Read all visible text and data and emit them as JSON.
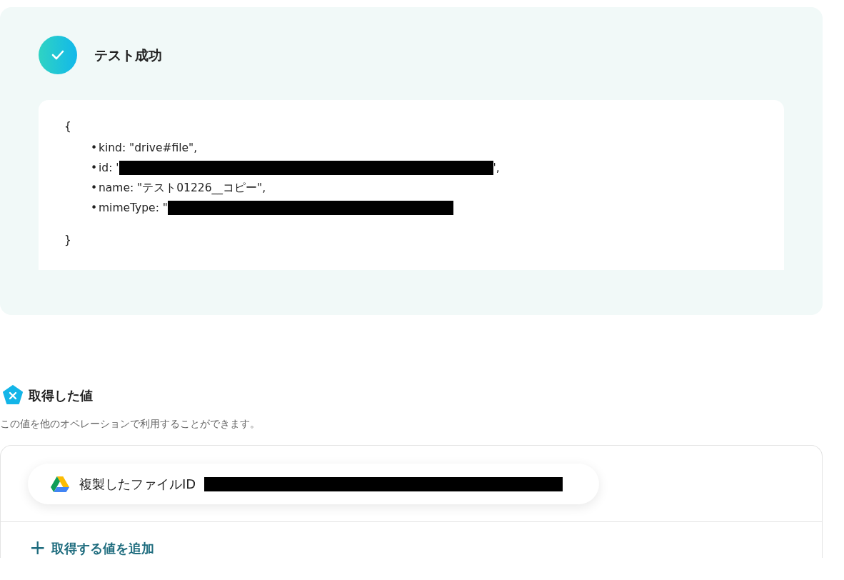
{
  "result": {
    "title": "テスト成功",
    "output": {
      "open": "{",
      "close": "}",
      "items": [
        {
          "bullet": "•",
          "before": "kind: \"drive#file\","
        },
        {
          "bullet": "•",
          "before": "id: '",
          "redacted": true,
          "after": "',"
        },
        {
          "bullet": "•",
          "before": "name: \"テスト01226__コピー\","
        },
        {
          "bullet": "•",
          "before": "mimeType: \"",
          "redacted": true
        }
      ]
    }
  },
  "values": {
    "title": "取得した値",
    "description": "この値を他のオペレーションで利用することができます。",
    "items": [
      {
        "label": "複製したファイルID",
        "redacted": true
      }
    ],
    "add_button": {
      "icon": "+",
      "label": "取得する値を追加"
    }
  }
}
